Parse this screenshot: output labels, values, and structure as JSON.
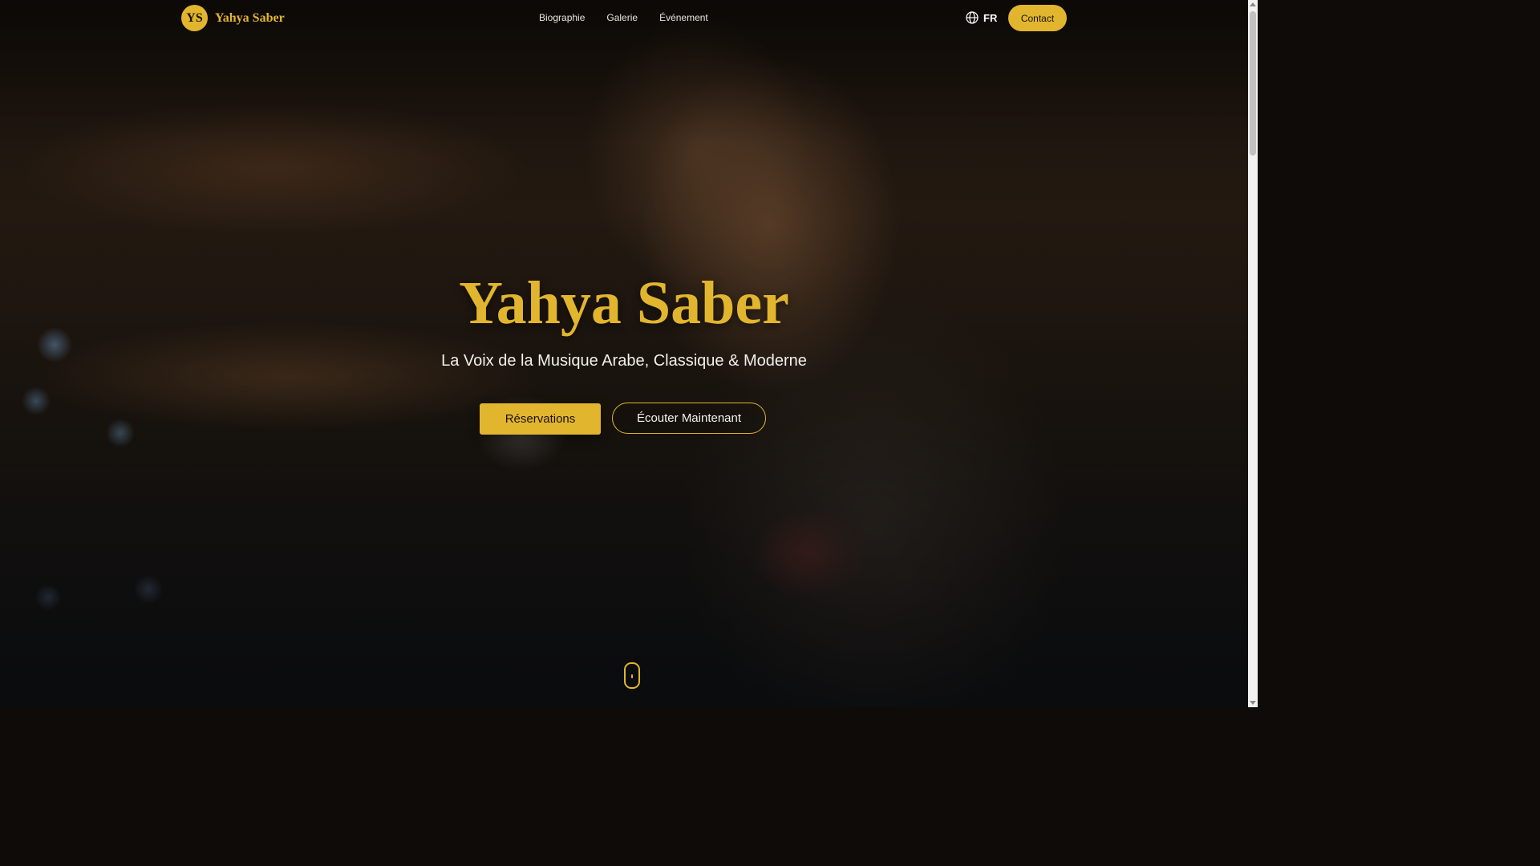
{
  "brand": {
    "initials": "YS",
    "name": "Yahya Saber"
  },
  "nav": {
    "items": [
      {
        "label": "Biographie"
      },
      {
        "label": "Galerie"
      },
      {
        "label": "Événement"
      }
    ]
  },
  "language": {
    "current": "FR",
    "icon": "globe-icon"
  },
  "header": {
    "contact_label": "Contact"
  },
  "hero": {
    "title": "Yahya Saber",
    "subtitle": "La Voix de la Musique Arabe, Classique & Moderne",
    "primary_button": "Réservations",
    "secondary_button": "Écouter Maintenant",
    "scroll_icon": "mouse-scroll-icon"
  },
  "colors": {
    "accent": "#e2b52e",
    "text_light": "#f2f0ec",
    "background_dark": "#0e0b08"
  }
}
